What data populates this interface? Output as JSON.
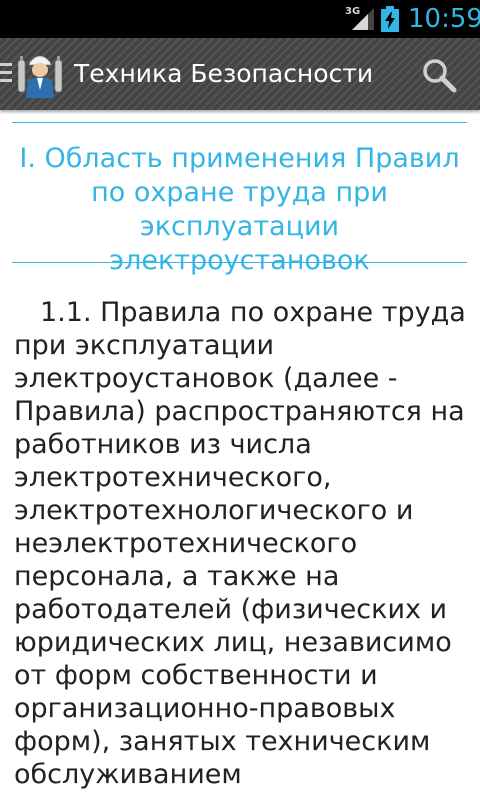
{
  "status_bar": {
    "network": "3G",
    "time": "10:59",
    "time_color": "#33b5e5"
  },
  "action_bar": {
    "title": "Техника Безопасности",
    "icons": [
      "drawer-icon",
      "app-logo-icon",
      "search-icon"
    ]
  },
  "content": {
    "section_title": "I. Область применения Правил по охране труда при эксплуатации электроустановок",
    "paragraph": "1.1. Правила по охране труда при эксплуатации электроустановок (далее - Правила) распространяются на работников из числа электротехнического, электротехнологического и неэлектротехнического персонала, а также на работодателей (физических и юридических лиц, независимо от форм собственности и организационно-правовых форм), занятых техническим обслуживанием",
    "accent_color": "#33b5e5"
  }
}
